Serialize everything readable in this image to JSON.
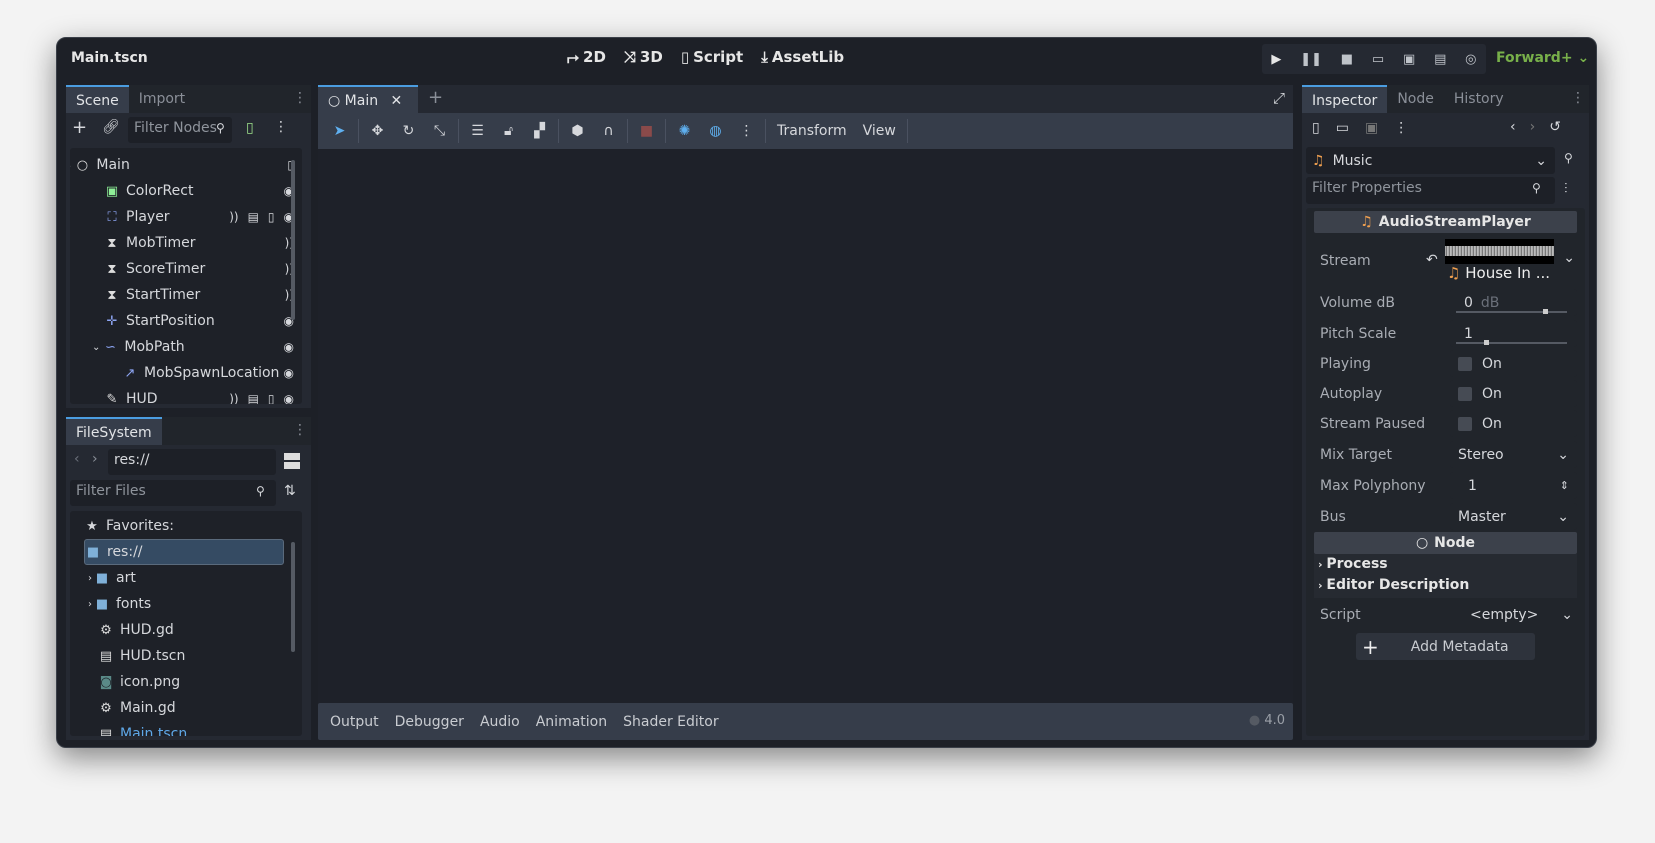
{
  "window": {
    "title": "Main.tscn"
  },
  "workspaces": [
    {
      "icon": "2d-icon",
      "label": "2D"
    },
    {
      "icon": "3d-icon",
      "label": "3D"
    },
    {
      "icon": "script-icon",
      "label": "Script"
    },
    {
      "icon": "download-icon",
      "label": "AssetLib"
    }
  ],
  "run_buttons": [
    "play-icon",
    "pause-icon",
    "stop-icon",
    "remote-debug-icon",
    "play-scene-icon",
    "play-custom-scene-icon",
    "movie-maker-icon"
  ],
  "renderer": "Forward+",
  "scene_dock": {
    "tabs": [
      "Scene",
      "Import"
    ],
    "filter_placeholder": "Filter Nodes",
    "nodes": [
      {
        "name": "Main",
        "icon": "node-icon",
        "depth": 0,
        "expanded": true,
        "badges": [
          "script-icon"
        ]
      },
      {
        "name": "ColorRect",
        "icon": "colorrect-icon",
        "depth": 1,
        "badges": [
          "visibility-icon"
        ]
      },
      {
        "name": "Player",
        "icon": "player-icon",
        "depth": 1,
        "badges": [
          "signal-icon",
          "instance-icon",
          "script-icon",
          "visibility-icon"
        ]
      },
      {
        "name": "MobTimer",
        "icon": "timer-icon",
        "depth": 1,
        "badges": [
          "signal-icon"
        ]
      },
      {
        "name": "ScoreTimer",
        "icon": "timer-icon",
        "depth": 1,
        "badges": [
          "signal-icon"
        ]
      },
      {
        "name": "StartTimer",
        "icon": "timer-icon",
        "depth": 1,
        "badges": [
          "signal-icon"
        ]
      },
      {
        "name": "StartPosition",
        "icon": "marker-icon",
        "depth": 1,
        "badges": [
          "visibility-icon"
        ]
      },
      {
        "name": "MobPath",
        "icon": "path-icon",
        "depth": 1,
        "expanded": true,
        "badges": [
          "visibility-icon"
        ]
      },
      {
        "name": "MobSpawnLocation",
        "icon": "pathfollow-icon",
        "depth": 2,
        "badges": [
          "visibility-icon"
        ]
      },
      {
        "name": "HUD",
        "icon": "canvaslayer-icon",
        "depth": 1,
        "badges": [
          "signal-icon",
          "instance-icon",
          "script-icon",
          "visibility-icon"
        ]
      }
    ]
  },
  "filesystem": {
    "tab": "FileSystem",
    "path": "res://",
    "filter_placeholder": "Filter Files",
    "favorites": "Favorites:",
    "items": [
      {
        "name": "res://",
        "icon": "folder-icon",
        "depth": 0,
        "selected": true
      },
      {
        "name": "art",
        "icon": "folder-icon",
        "depth": 1
      },
      {
        "name": "fonts",
        "icon": "folder-icon",
        "depth": 1
      },
      {
        "name": "HUD.gd",
        "icon": "gear-icon",
        "depth": 1
      },
      {
        "name": "HUD.tscn",
        "icon": "scene-icon",
        "depth": 1
      },
      {
        "name": "icon.png",
        "icon": "image-icon",
        "depth": 1
      },
      {
        "name": "Main.gd",
        "icon": "gear-icon",
        "depth": 1
      },
      {
        "name": "Main.tscn",
        "icon": "scene-icon",
        "depth": 1,
        "active": true
      }
    ]
  },
  "editor": {
    "tab": "Main",
    "toolbar_menus": [
      "Transform",
      "View"
    ]
  },
  "bottom_panel": {
    "tabs": [
      "Output",
      "Debugger",
      "Audio",
      "Animation",
      "Shader Editor"
    ],
    "version": "4.0"
  },
  "inspector": {
    "tabs": [
      "Inspector",
      "Node",
      "History"
    ],
    "object": "Music",
    "filter_placeholder": "Filter Properties",
    "class_header": "AudioStreamPlayer",
    "stream": {
      "label": "Stream",
      "value": "House In ..."
    },
    "volume": {
      "label": "Volume dB",
      "value": "0",
      "unit": "dB",
      "slider": 0.78
    },
    "pitch": {
      "label": "Pitch Scale",
      "value": "1",
      "slider": 0.25
    },
    "playing": {
      "label": "Playing",
      "value": "On"
    },
    "autoplay": {
      "label": "Autoplay",
      "value": "On"
    },
    "stream_paused": {
      "label": "Stream Paused",
      "value": "On"
    },
    "mix_target": {
      "label": "Mix Target",
      "value": "Stereo"
    },
    "max_polyphony": {
      "label": "Max Polyphony",
      "value": "1"
    },
    "bus": {
      "label": "Bus",
      "value": "Master"
    },
    "node_header": "Node",
    "process": "Process",
    "editor_description": "Editor Description",
    "script": {
      "label": "Script",
      "value": "<empty>"
    },
    "add_metadata": "Add Metadata"
  },
  "colors": {
    "accent": "#4b9de0",
    "renderer": "#78b04a",
    "link": "#5fa8e8"
  }
}
